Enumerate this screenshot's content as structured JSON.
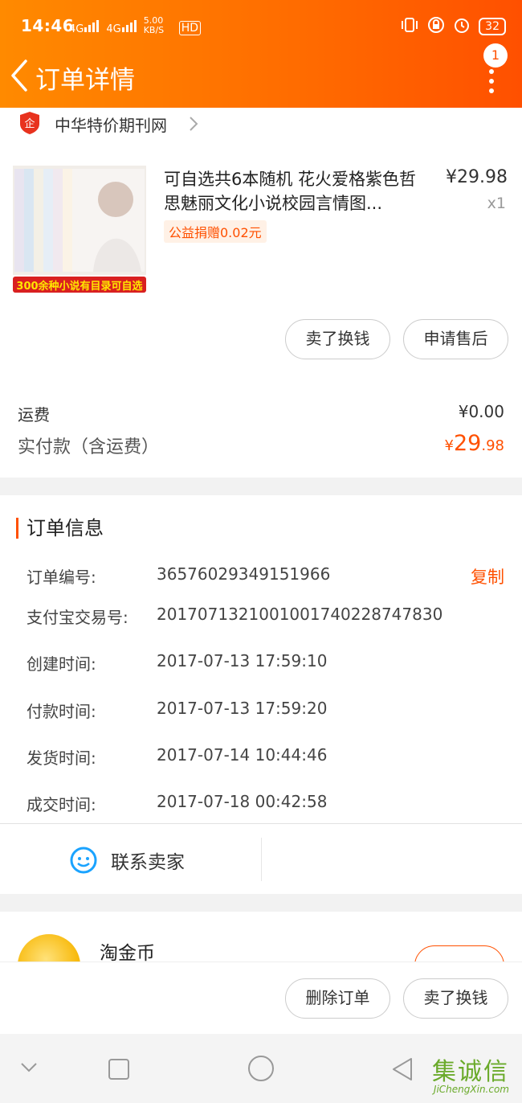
{
  "status_bar": {
    "time": "14:46",
    "signal1": "4G",
    "signal2": "4G",
    "speed": "5.00 KB/S",
    "hd": "HD",
    "battery": "32"
  },
  "nav": {
    "title": "订单详情",
    "badge": "1"
  },
  "shop": {
    "name": "中华特价期刊网",
    "icon_text": "企"
  },
  "product": {
    "title": "可自选共6本随机 花火爱格紫色哲思魅丽文化小说校园言情图...",
    "price": "¥29.98",
    "qty": "x1",
    "charity": "公益捐赠0.02元",
    "image_banner": "300余种小说有目录可自选"
  },
  "item_actions": {
    "sell": "卖了换钱",
    "after_sale": "申请售后"
  },
  "fees": {
    "shipping_label": "运费",
    "shipping_value": "¥0.00",
    "paid_label": "实付款（含运费）",
    "paid_currency": "¥",
    "paid_int": "29",
    "paid_dec": ".98"
  },
  "order_info": {
    "title": "订单信息",
    "copy": "复制",
    "rows": [
      {
        "label": "订单编号:",
        "value": "36576029349151966"
      },
      {
        "label": "支付宝交易号:",
        "value": "2017071321001001740228747830"
      },
      {
        "label": "创建时间:",
        "value": "2017-07-13 17:59:10"
      },
      {
        "label": "付款时间:",
        "value": "2017-07-13 17:59:20"
      },
      {
        "label": "发货时间:",
        "value": "2017-07-14 10:44:46"
      },
      {
        "label": "成交时间:",
        "value": "2017-07-18 00:42:58"
      }
    ],
    "contact": "联系卖家"
  },
  "coin": {
    "label": "淘金币"
  },
  "bottom_actions": {
    "delete": "删除订单",
    "sell": "卖了换钱"
  },
  "watermark": {
    "text": "JiChengXin.com",
    "big": "集诚信"
  },
  "colors": {
    "accent": "#ff5000",
    "header_start": "#ff8a00"
  }
}
